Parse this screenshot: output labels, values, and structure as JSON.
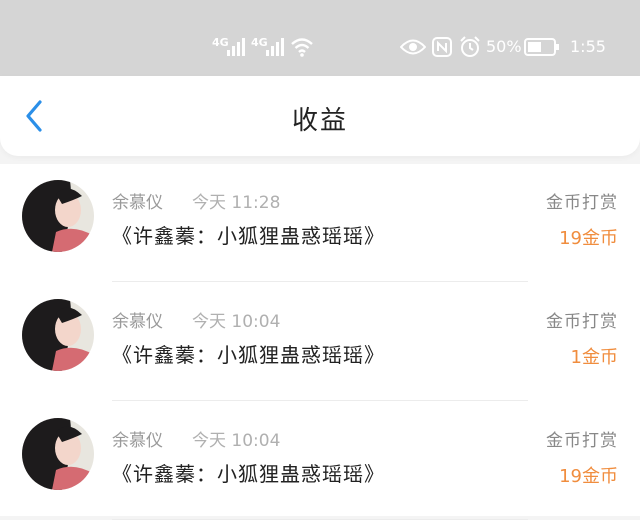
{
  "status_bar": {
    "signal1_label": "4G",
    "signal2_label": "4G",
    "battery_percent": "50%",
    "time": "1:55",
    "icons": [
      "signal-icon",
      "signal-icon",
      "wifi-icon",
      "eye-icon",
      "nfc-icon",
      "alarm-icon",
      "battery-icon"
    ]
  },
  "header": {
    "title": "收益"
  },
  "list": {
    "items": [
      {
        "name": "余慕仪",
        "time": "今天 11:28",
        "title": "《许鑫蓁：小狐狸蛊惑瑶瑶》",
        "type": "金币打赏",
        "amount": "19金币"
      },
      {
        "name": "余慕仪",
        "time": "今天 10:04",
        "title": "《许鑫蓁：小狐狸蛊惑瑶瑶》",
        "type": "金币打赏",
        "amount": "1金币"
      },
      {
        "name": "余慕仪",
        "time": "今天 10:04",
        "title": "《许鑫蓁：小狐狸蛊惑瑶瑶》",
        "type": "金币打赏",
        "amount": "19金币"
      }
    ]
  },
  "colors": {
    "accent": "#2b8fe8",
    "amount": "#f08d3e",
    "status_bar_bg": "#d5d5d5"
  }
}
